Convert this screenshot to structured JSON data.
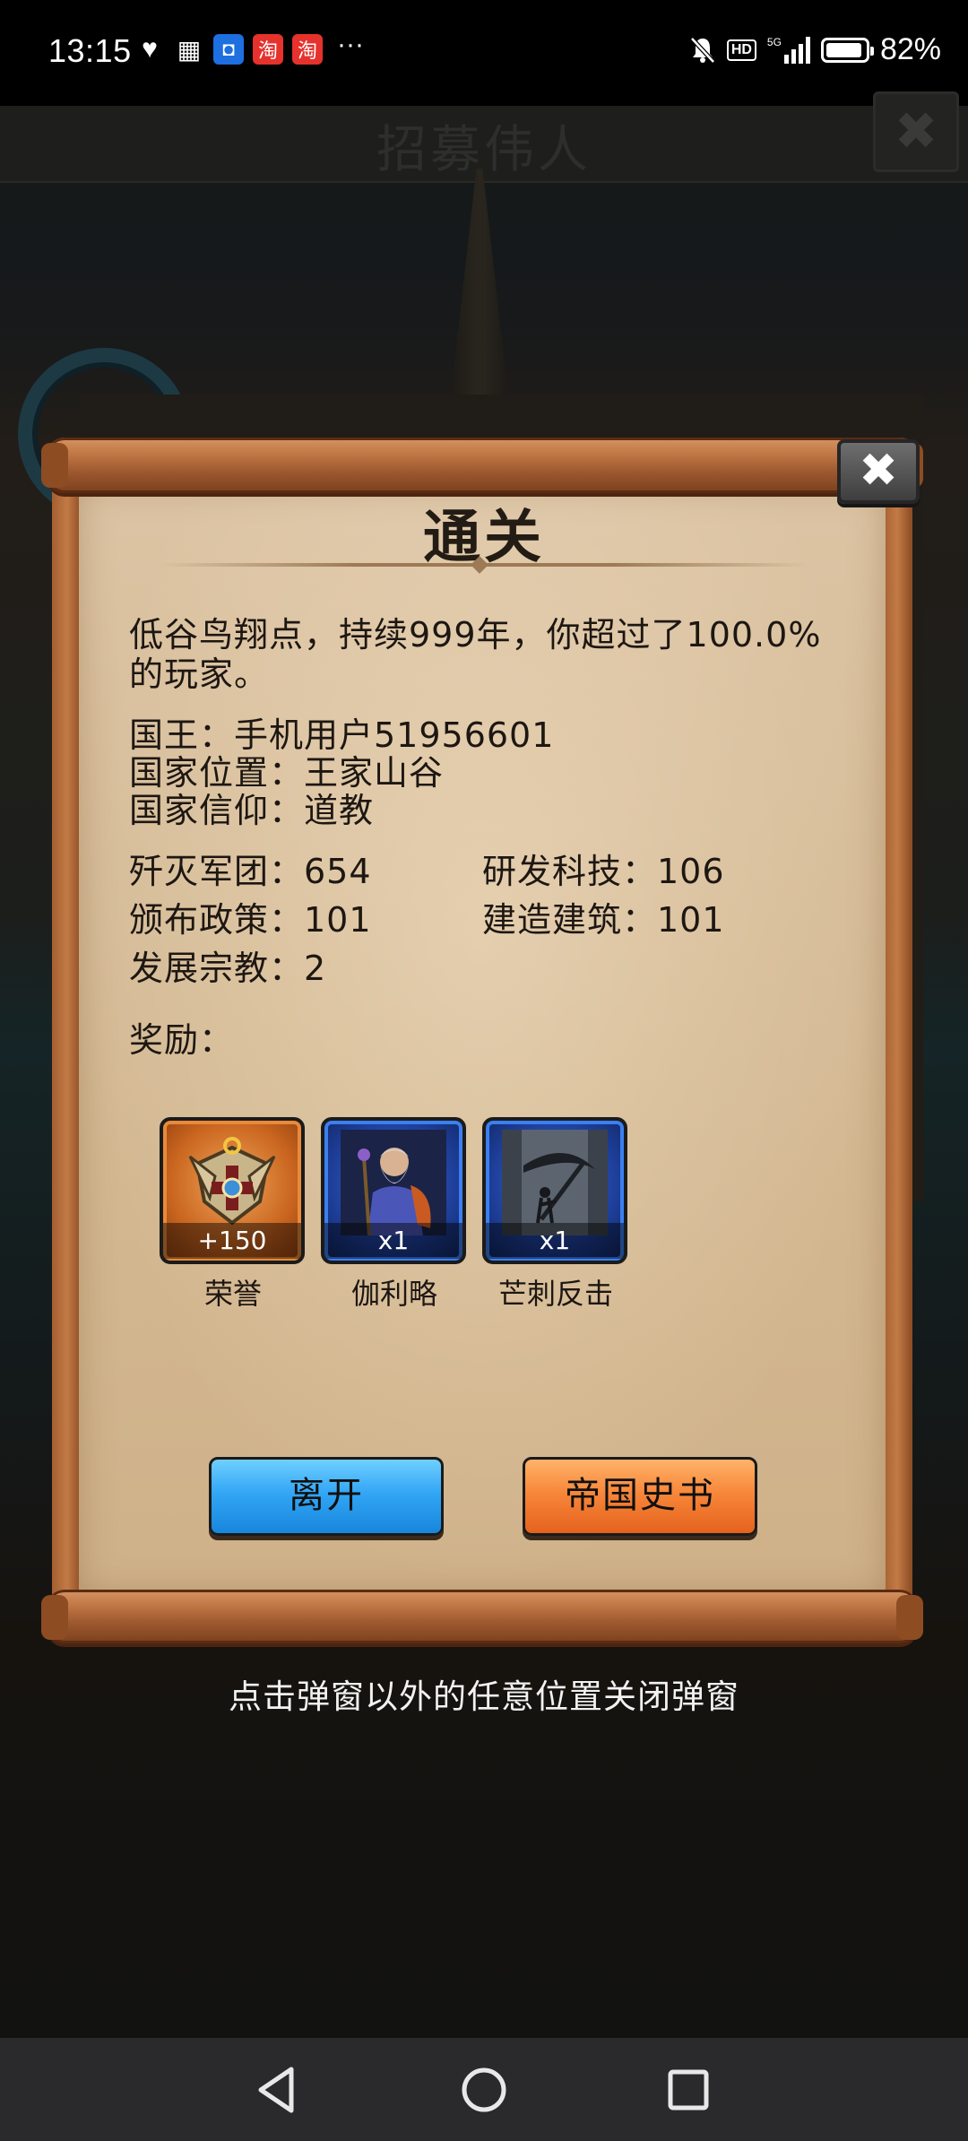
{
  "status_bar": {
    "time": "13:15",
    "more": "···",
    "battery": "82%",
    "battery_level": 0.82,
    "hd": "HD",
    "network": "5G",
    "app_icon_taobao": "淘"
  },
  "background": {
    "title": "招募伟人"
  },
  "modal": {
    "close_icon": "✖",
    "title": "通关",
    "summary": "低谷鸟翔点，持续999年，你超过了100.0%的玩家。",
    "info": [
      "国王：手机用户51956601",
      "国家位置：王家山谷",
      "国家信仰：道教"
    ],
    "stats": [
      "歼灭军团：654",
      "研发科技：106",
      "颁布政策：101",
      "建造建筑：101",
      "发展宗教：2"
    ],
    "rewards_label": "奖励：",
    "rewards": [
      {
        "name": "荣誉",
        "qty": "+150",
        "frame": "orange",
        "icon": "honor-emblem-icon"
      },
      {
        "name": "伽利略",
        "qty": "x1",
        "frame": "blue",
        "icon": "galileo-portrait-icon"
      },
      {
        "name": "芒刺反击",
        "qty": "x1",
        "frame": "blue",
        "icon": "thorn-counter-icon"
      }
    ],
    "buttons": {
      "leave": "离开",
      "history": "帝国史书"
    }
  },
  "hint": "点击弹窗以外的任意位置关闭弹窗",
  "colors": {
    "leave_button": "#33a6f5",
    "history_button": "#f7873a",
    "parchment": "#d3b892",
    "scroll_wood": "#c07745"
  }
}
